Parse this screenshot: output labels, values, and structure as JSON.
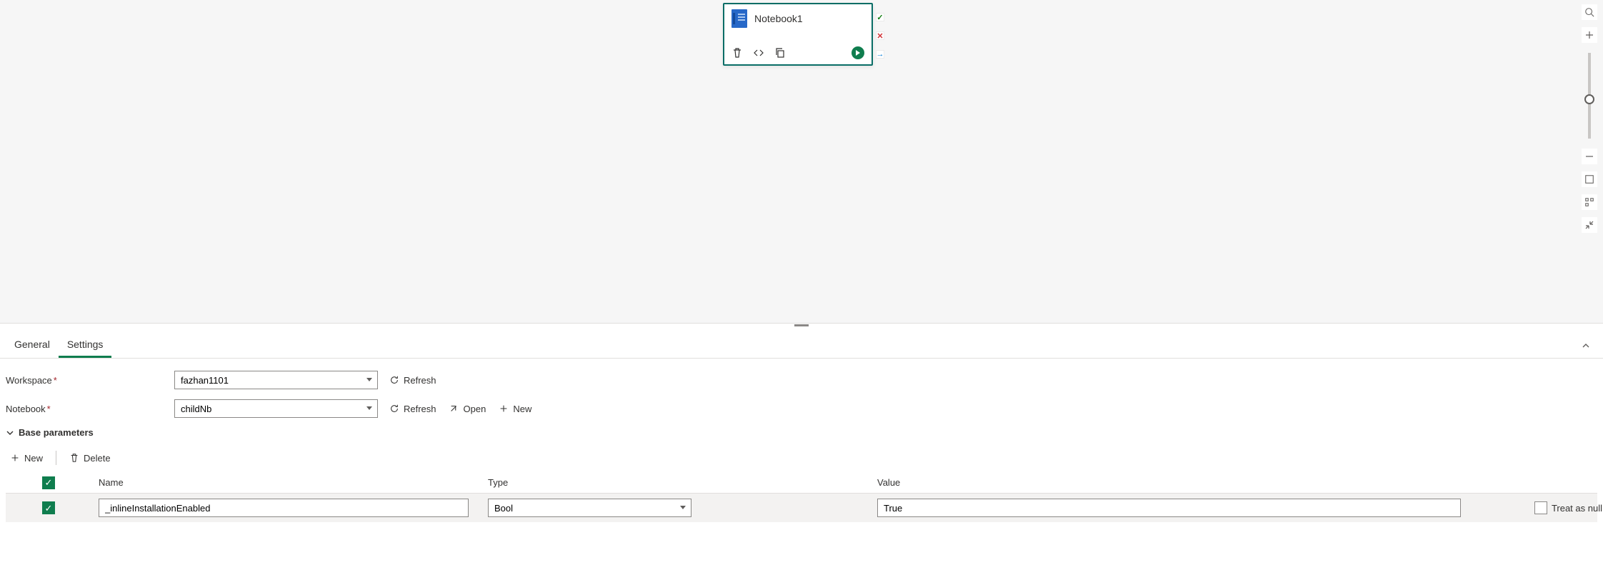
{
  "node": {
    "title": "Notebook1"
  },
  "tabs": {
    "general": "General",
    "settings": "Settings"
  },
  "form": {
    "workspace_label": "Workspace",
    "workspace_value": "fazhan1101",
    "notebook_label": "Notebook",
    "notebook_value": "childNb",
    "refresh": "Refresh",
    "open": "Open",
    "new": "New"
  },
  "section": {
    "title": "Base parameters",
    "new": "New",
    "delete": "Delete"
  },
  "grid": {
    "headers": {
      "name": "Name",
      "type": "Type",
      "value": "Value"
    },
    "treat_as_null": "Treat as null",
    "rows": [
      {
        "name": "_inlineInstallationEnabled",
        "type": "Bool",
        "value": "True",
        "treat_as_null": false
      }
    ]
  }
}
